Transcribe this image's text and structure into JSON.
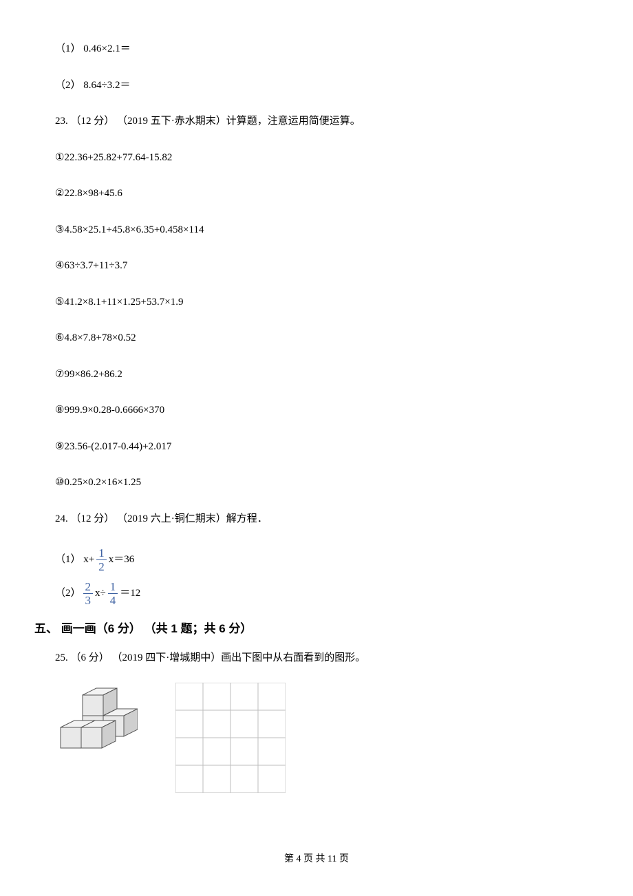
{
  "q22_1": "（1） 0.46×2.1＝",
  "q22_2": "（2） 8.64÷3.2＝",
  "q23_prompt": "23. （12 分） （2019 五下·赤水期末）计算题，注意运用简便运算。",
  "q23_items": {
    "i1": "①22.36+25.82+77.64-15.82",
    "i2": "②22.8×98+45.6",
    "i3": "③4.58×25.1+45.8×6.35+0.458×114",
    "i4": "④63÷3.7+11÷3.7",
    "i5": "⑤41.2×8.1+11×1.25+53.7×1.9",
    "i6": "⑥4.8×7.8+78×0.52",
    "i7": "⑦99×86.2+86.2",
    "i8": "⑧999.9×0.28-0.6666×370",
    "i9": "⑨23.56-(2.017-0.44)+2.017",
    "i10": "⑩0.25×0.2×16×1.25"
  },
  "q24_prompt": "24. （12 分） （2019 六上·铜仁期末）解方程．",
  "q24_1_prefix": "（1） x+ ",
  "q24_1_frac_num": "1",
  "q24_1_frac_den": "2",
  "q24_1_suffix": " x＝36",
  "q24_2_prefix": "（2） ",
  "q24_2_frac1_num": "2",
  "q24_2_frac1_den": "3",
  "q24_2_mid": " x÷ ",
  "q24_2_frac2_num": "1",
  "q24_2_frac2_den": "4",
  "q24_2_suffix": " ＝12",
  "section5_header": "五、 画一画（6 分） （共 1 题；共 6 分）",
  "q25_prompt": "25. （6 分） （2019 四下·增城期中）画出下图中从右面看到的图形。",
  "footer": "第 4 页 共 11 页"
}
